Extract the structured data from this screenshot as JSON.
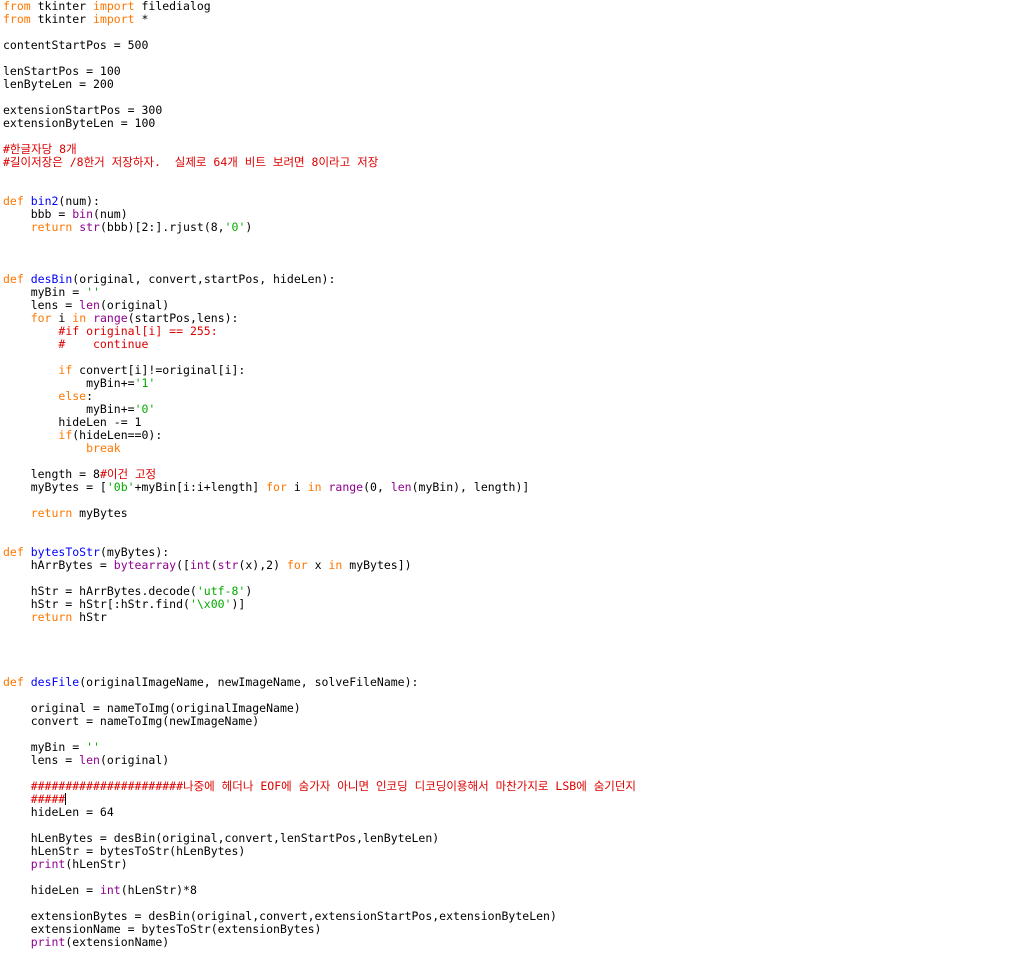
{
  "theme": {
    "background": "#ffffff",
    "default": "#000000",
    "keyword": "#ff7700",
    "builtin": "#900090",
    "definition": "#0000ff",
    "string": "#00aa00",
    "comment": "#dd0000"
  },
  "editor": {
    "lines": [
      [
        {
          "t": "from",
          "c": "kw"
        },
        {
          "t": " tkinter "
        },
        {
          "t": "import",
          "c": "kw"
        },
        {
          "t": " filedialog"
        }
      ],
      [
        {
          "t": "from",
          "c": "kw"
        },
        {
          "t": " tkinter "
        },
        {
          "t": "import",
          "c": "kw"
        },
        {
          "t": " *"
        }
      ],
      [],
      [
        {
          "t": "contentStartPos = 500"
        }
      ],
      [],
      [
        {
          "t": "lenStartPos = 100"
        }
      ],
      [
        {
          "t": "lenByteLen = 200"
        }
      ],
      [],
      [
        {
          "t": "extensionStartPos = 300"
        }
      ],
      [
        {
          "t": "extensionByteLen = 100"
        }
      ],
      [],
      [
        {
          "t": "#한글자당 8개",
          "c": "cm"
        }
      ],
      [
        {
          "t": "#길이저장은 /8한거 저장하자.  실제로 64개 비트 보려면 8이라고 저장",
          "c": "cm"
        }
      ],
      [],
      [],
      [
        {
          "t": "def",
          "c": "kw"
        },
        {
          "t": " "
        },
        {
          "t": "bin2",
          "c": "fn"
        },
        {
          "t": "(num):"
        }
      ],
      [
        {
          "t": "    bbb = "
        },
        {
          "t": "bin",
          "c": "bi"
        },
        {
          "t": "(num)"
        }
      ],
      [
        {
          "t": "    "
        },
        {
          "t": "return",
          "c": "kw"
        },
        {
          "t": " "
        },
        {
          "t": "str",
          "c": "bi"
        },
        {
          "t": "(bbb)[2:].rjust(8,"
        },
        {
          "t": "'0'",
          "c": "str"
        },
        {
          "t": ")"
        }
      ],
      [],
      [],
      [],
      [
        {
          "t": "def",
          "c": "kw"
        },
        {
          "t": " "
        },
        {
          "t": "desBin",
          "c": "fn"
        },
        {
          "t": "(original, convert,startPos, hideLen):"
        }
      ],
      [
        {
          "t": "    myBin = "
        },
        {
          "t": "''",
          "c": "str"
        }
      ],
      [
        {
          "t": "    lens = "
        },
        {
          "t": "len",
          "c": "bi"
        },
        {
          "t": "(original)"
        }
      ],
      [
        {
          "t": "    "
        },
        {
          "t": "for",
          "c": "kw"
        },
        {
          "t": " i "
        },
        {
          "t": "in",
          "c": "kw"
        },
        {
          "t": " "
        },
        {
          "t": "range",
          "c": "bi"
        },
        {
          "t": "(startPos,lens):"
        }
      ],
      [
        {
          "t": "        "
        },
        {
          "t": "#if original[i] == 255:",
          "c": "cm"
        }
      ],
      [
        {
          "t": "        "
        },
        {
          "t": "#    continue",
          "c": "cm"
        }
      ],
      [],
      [
        {
          "t": "        "
        },
        {
          "t": "if",
          "c": "kw"
        },
        {
          "t": " convert[i]!=original[i]:"
        }
      ],
      [
        {
          "t": "            myBin+="
        },
        {
          "t": "'1'",
          "c": "str"
        }
      ],
      [
        {
          "t": "        "
        },
        {
          "t": "else",
          "c": "kw"
        },
        {
          "t": ":"
        }
      ],
      [
        {
          "t": "            myBin+="
        },
        {
          "t": "'0'",
          "c": "str"
        }
      ],
      [
        {
          "t": "        hideLen -= 1"
        }
      ],
      [
        {
          "t": "        "
        },
        {
          "t": "if",
          "c": "kw"
        },
        {
          "t": "(hideLen==0):"
        }
      ],
      [
        {
          "t": "            "
        },
        {
          "t": "break",
          "c": "kw"
        }
      ],
      [],
      [
        {
          "t": "    length = 8"
        },
        {
          "t": "#이건 고정",
          "c": "cm"
        }
      ],
      [
        {
          "t": "    myBytes = ["
        },
        {
          "t": "'0b'",
          "c": "str"
        },
        {
          "t": "+myBin[i:i+length] "
        },
        {
          "t": "for",
          "c": "kw"
        },
        {
          "t": " i "
        },
        {
          "t": "in",
          "c": "kw"
        },
        {
          "t": " "
        },
        {
          "t": "range",
          "c": "bi"
        },
        {
          "t": "(0, "
        },
        {
          "t": "len",
          "c": "bi"
        },
        {
          "t": "(myBin), length)]"
        }
      ],
      [],
      [
        {
          "t": "    "
        },
        {
          "t": "return",
          "c": "kw"
        },
        {
          "t": " myBytes"
        }
      ],
      [],
      [],
      [
        {
          "t": "def",
          "c": "kw"
        },
        {
          "t": " "
        },
        {
          "t": "bytesToStr",
          "c": "fn"
        },
        {
          "t": "(myBytes):"
        }
      ],
      [
        {
          "t": "    hArrBytes = "
        },
        {
          "t": "bytearray",
          "c": "bi"
        },
        {
          "t": "(["
        },
        {
          "t": "int",
          "c": "bi"
        },
        {
          "t": "("
        },
        {
          "t": "str",
          "c": "bi"
        },
        {
          "t": "(x),2) "
        },
        {
          "t": "for",
          "c": "kw"
        },
        {
          "t": " x "
        },
        {
          "t": "in",
          "c": "kw"
        },
        {
          "t": " myBytes])"
        }
      ],
      [],
      [
        {
          "t": "    hStr = hArrBytes.decode("
        },
        {
          "t": "'utf-8'",
          "c": "str"
        },
        {
          "t": ")"
        }
      ],
      [
        {
          "t": "    hStr = hStr[:hStr.find("
        },
        {
          "t": "'\\x00'",
          "c": "str"
        },
        {
          "t": ")]"
        }
      ],
      [
        {
          "t": "    "
        },
        {
          "t": "return",
          "c": "kw"
        },
        {
          "t": " hStr"
        }
      ],
      [],
      [],
      [],
      [],
      [
        {
          "t": "def",
          "c": "kw"
        },
        {
          "t": " "
        },
        {
          "t": "desFile",
          "c": "fn"
        },
        {
          "t": "(originalImageName, newImageName, solveFileName):"
        }
      ],
      [],
      [
        {
          "t": "    original = nameToImg(originalImageName)"
        }
      ],
      [
        {
          "t": "    convert = nameToImg(newImageName)"
        }
      ],
      [],
      [
        {
          "t": "    myBin = "
        },
        {
          "t": "''",
          "c": "str"
        }
      ],
      [
        {
          "t": "    lens = "
        },
        {
          "t": "len",
          "c": "bi"
        },
        {
          "t": "(original)"
        }
      ],
      [],
      [
        {
          "t": "    "
        },
        {
          "t": "######################나중에 헤더나 EOF에 숨가자 아니면 인코딩 디코딩이용해서 마찬가지로 LSB에 숨기던지",
          "c": "cm"
        }
      ],
      [
        {
          "t": "    "
        },
        {
          "t": "#####",
          "c": "cm"
        },
        {
          "t": "",
          "caret": true
        }
      ],
      [
        {
          "t": "    hideLen = 64"
        }
      ],
      [],
      [
        {
          "t": "    hLenBytes = desBin(original,convert,lenStartPos,lenByteLen)"
        }
      ],
      [
        {
          "t": "    hLenStr = bytesToStr(hLenBytes)"
        }
      ],
      [
        {
          "t": "    "
        },
        {
          "t": "print",
          "c": "bi"
        },
        {
          "t": "(hLenStr)"
        }
      ],
      [],
      [
        {
          "t": "    hideLen = "
        },
        {
          "t": "int",
          "c": "bi"
        },
        {
          "t": "(hLenStr)*8"
        }
      ],
      [],
      [
        {
          "t": "    extensionBytes = desBin(original,convert,extensionStartPos,extensionByteLen)"
        }
      ],
      [
        {
          "t": "    extensionName = bytesToStr(extensionBytes)"
        }
      ],
      [
        {
          "t": "    "
        },
        {
          "t": "print",
          "c": "bi"
        },
        {
          "t": "(extensionName)"
        }
      ]
    ]
  }
}
